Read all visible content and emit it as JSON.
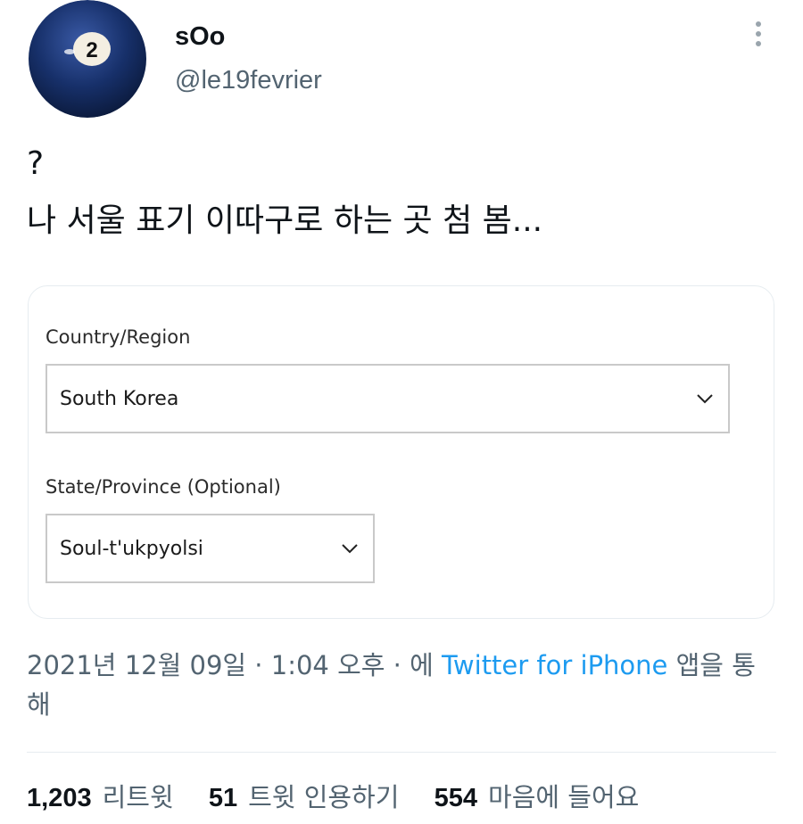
{
  "user": {
    "display_name": "sOo",
    "handle": "@le19fevrier",
    "avatar_icon": "billiard-ball-2-icon",
    "avatar_number": "2"
  },
  "tweet": {
    "text": "?\n나 서울 표기 이따구로 하는 곳 첨 봄..."
  },
  "form": {
    "country_label": "Country/Region",
    "country_value": "South Korea",
    "state_label": "State/Province (Optional)",
    "state_value": "Soul-t'ukpyolsi"
  },
  "meta": {
    "prefix": "2021년 12월 09일 · 1:04 오후 · 에 ",
    "source": "Twitter for iPhone",
    "suffix": " 앱을 통해"
  },
  "stats": {
    "retweets_count": "1,203",
    "retweets_label": "리트윗",
    "quotes_count": "51",
    "quotes_label": "트윗 인용하기",
    "likes_count": "554",
    "likes_label": "마음에 들어요"
  },
  "colors": {
    "link": "#1d9bf0",
    "secondary_text": "#536471",
    "avatar_ball": "#17306a"
  }
}
